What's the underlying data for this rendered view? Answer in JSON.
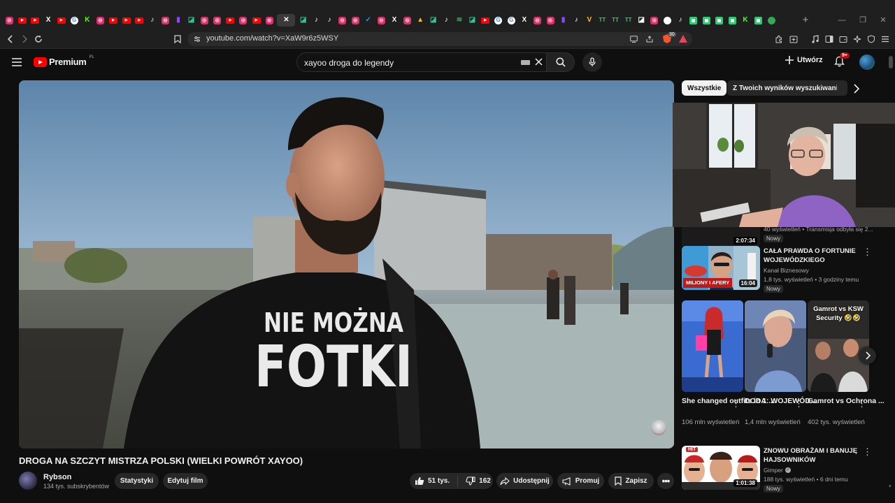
{
  "browser": {
    "tab_favicons": [
      {
        "icon": "instagram-icon",
        "color": "#d6336c"
      },
      {
        "icon": "youtube-icon",
        "color": "#ff0000"
      },
      {
        "icon": "youtube-icon",
        "color": "#ff0000"
      },
      {
        "icon": "x-icon",
        "color": "#ffffff"
      },
      {
        "icon": "youtube-icon",
        "color": "#ff0000"
      },
      {
        "icon": "google-icon",
        "color": "#4285f4"
      },
      {
        "icon": "kick-icon",
        "color": "#53fc18"
      },
      {
        "icon": "instagram-icon",
        "color": "#d6336c"
      },
      {
        "icon": "youtube-icon",
        "color": "#ff0000"
      },
      {
        "icon": "youtube-icon",
        "color": "#ff0000"
      },
      {
        "icon": "youtube-icon",
        "color": "#ff0000"
      },
      {
        "icon": "tiktok-icon",
        "color": "#ffffff"
      },
      {
        "icon": "instagram-icon",
        "color": "#d6336c"
      },
      {
        "icon": "twitch-icon",
        "color": "#9146ff"
      },
      {
        "icon": "chat-icon",
        "color": "#34c38f"
      },
      {
        "icon": "instagram-icon",
        "color": "#e1306c"
      },
      {
        "icon": "instagram-icon",
        "color": "#e1306c"
      },
      {
        "icon": "youtube-icon",
        "color": "#ff0000"
      },
      {
        "icon": "instagram-icon",
        "color": "#d6336c"
      },
      {
        "icon": "youtube-icon",
        "color": "#ff0000"
      },
      {
        "icon": "instagram-icon",
        "color": "#d6336c"
      },
      {
        "icon": "close-icon",
        "color": "#ffffff",
        "active": true
      },
      {
        "icon": "chat-icon",
        "color": "#34c38f"
      },
      {
        "icon": "tiktok-icon",
        "color": "#ffffff"
      },
      {
        "icon": "tiktok-icon",
        "color": "#ffffff"
      },
      {
        "icon": "instagram-icon",
        "color": "#d6336c"
      },
      {
        "icon": "instagram-icon",
        "color": "#d6336c"
      },
      {
        "icon": "check-icon",
        "color": "#1d9bf0"
      },
      {
        "icon": "instagram-icon",
        "color": "#d6336c"
      },
      {
        "icon": "x-icon",
        "color": "#ffffff"
      },
      {
        "icon": "instagram-icon",
        "color": "#d6336c"
      },
      {
        "icon": "drive-icon",
        "color": "#fbbc04"
      },
      {
        "icon": "chat-icon",
        "color": "#34c38f"
      },
      {
        "icon": "tiktok-icon",
        "color": "#ffffff"
      },
      {
        "icon": "spotify-icon",
        "color": "#1db954"
      },
      {
        "icon": "chat-icon",
        "color": "#34c38f"
      },
      {
        "icon": "youtube-icon",
        "color": "#ff0000"
      },
      {
        "icon": "google-icon",
        "color": "#4285f4"
      },
      {
        "icon": "google-icon",
        "color": "#4285f4"
      },
      {
        "icon": "x-icon",
        "color": "#ffffff"
      },
      {
        "icon": "instagram-icon",
        "color": "#e1306c"
      },
      {
        "icon": "instagram-icon",
        "color": "#e1306c"
      },
      {
        "icon": "twitch-icon",
        "color": "#9146ff"
      },
      {
        "icon": "tiktok-icon",
        "color": "#ffffff"
      },
      {
        "icon": "v-icon",
        "color": "#f5c518"
      },
      {
        "icon": "tt-icon",
        "color": "#2ecc71"
      },
      {
        "icon": "tt-icon",
        "color": "#2ecc71"
      },
      {
        "icon": "tt-icon",
        "color": "#2ecc71"
      },
      {
        "icon": "chat-icon",
        "color": "#ffffff"
      },
      {
        "icon": "instagram-icon",
        "color": "#d6336c"
      },
      {
        "icon": "record-icon",
        "color": "#ffffff"
      },
      {
        "icon": "tiktok-icon",
        "color": "#ffffff"
      },
      {
        "icon": "square-icon",
        "color": "#2ecc71"
      },
      {
        "icon": "square-icon",
        "color": "#2ecc71"
      },
      {
        "icon": "square-icon",
        "color": "#2ecc71"
      },
      {
        "icon": "square-icon",
        "color": "#2ecc71"
      },
      {
        "icon": "kick-icon",
        "color": "#53fc18"
      },
      {
        "icon": "square-icon",
        "color": "#2ecc71"
      },
      {
        "icon": "map-pin-icon",
        "color": "#34a853"
      }
    ],
    "url": "youtube.com/watch?v=XaW9r6z5WSY",
    "ext_badge": "30"
  },
  "youtube": {
    "logo_text": "Premium",
    "logo_region": "PL",
    "search_query": "xayoo droga do legendy",
    "create_label": "Utwórz",
    "notif_count": "9+",
    "video": {
      "title": "DROGA NA SZCZYT MISTRZA POLSKI (WIELKI POWRÓT XAYOO)",
      "shirt_text_line1": "NIE MOŻNA",
      "shirt_text_line2": "FOTKI",
      "channel_name": "Rybson",
      "subscribers": "134 tys. subskrybentów",
      "stats_label": "Statystyki",
      "edit_label": "Edytuj film",
      "likes": "51 tys.",
      "dislikes": "162",
      "share_label": "Udostępnij",
      "promote_label": "Promuj",
      "save_label": "Zapisz"
    },
    "chips": [
      "Wszystkie",
      "Z Twoich wyników wyszukiwania"
    ],
    "recommendations": [
      {
        "duration": "2:07:34",
        "meta": "40 wyświetleń • Transmisja odbyła się 2...",
        "badge": "Nowy"
      },
      {
        "title": "CAŁA PRAWDA O FORTUNIE WOJEWÓDZKIEGO",
        "channel": "Kanał Biznesowy",
        "meta": "1,8 tys. wyświetleń • 3 godziny temu",
        "badge": "Nowy",
        "duration": "16:04",
        "thumb_text": "MILIONY I AFERY"
      },
      {
        "title": "ZNOWU OBRAŻAM I BANUJĘ HAJSOWNIKÓW",
        "channel": "Gimper",
        "meta": "188 tys. wyświetleń • 6 dni temu",
        "badge": "Nowy",
        "duration": "1:01:38",
        "thumb_text": "HIT"
      }
    ],
    "shorts": [
      {
        "title": "She changed outfits in 1 ...",
        "views": "106 mln wyświetleń"
      },
      {
        "title": "DODA: WOJEWÓD...",
        "views": "1,4 mln wyświetleń"
      },
      {
        "title": "Gamrot vs Ochrona ...",
        "views": "402 tys. wyświetleń",
        "overlay": "Gamrot vs KSW Security 🤣🤣"
      }
    ]
  }
}
